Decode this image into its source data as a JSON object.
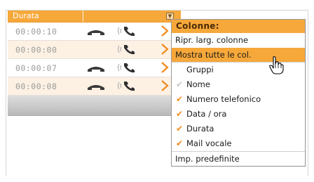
{
  "grid": {
    "header_label": "Durata",
    "rows": [
      {
        "time": "00:00:10",
        "handset_icon": "hangup-handset-icon",
        "ring_icon": "ringing-phone-icon"
      },
      {
        "time": "00:00:00",
        "handset_icon": "",
        "ring_icon": "ringing-phone-icon"
      },
      {
        "time": "00:00:07",
        "handset_icon": "hangup-handset-icon",
        "ring_icon": "ringing-phone-icon"
      },
      {
        "time": "00:00:08",
        "handset_icon": "hangup-handset-icon",
        "ring_icon": "ringing-phone-icon"
      }
    ]
  },
  "menu": {
    "title": "Colonne:",
    "restore_widths": "Ripr. larg. colonne",
    "show_all": "Mostra tutte le col.",
    "items": [
      {
        "label": "Gruppi",
        "checked": false
      },
      {
        "label": "Nome",
        "checked": false
      },
      {
        "label": "Numero telefonico",
        "checked": true
      },
      {
        "label": "Data / ora",
        "checked": true
      },
      {
        "label": "Durata",
        "checked": true
      },
      {
        "label": "Mail vocale",
        "checked": true
      }
    ],
    "defaults": "Imp. predefinite"
  },
  "colors": {
    "accent": "#f6a83a",
    "check": "#f08a1c",
    "chevron": "#f08a1c",
    "row_alt": "#fdf1e4"
  }
}
